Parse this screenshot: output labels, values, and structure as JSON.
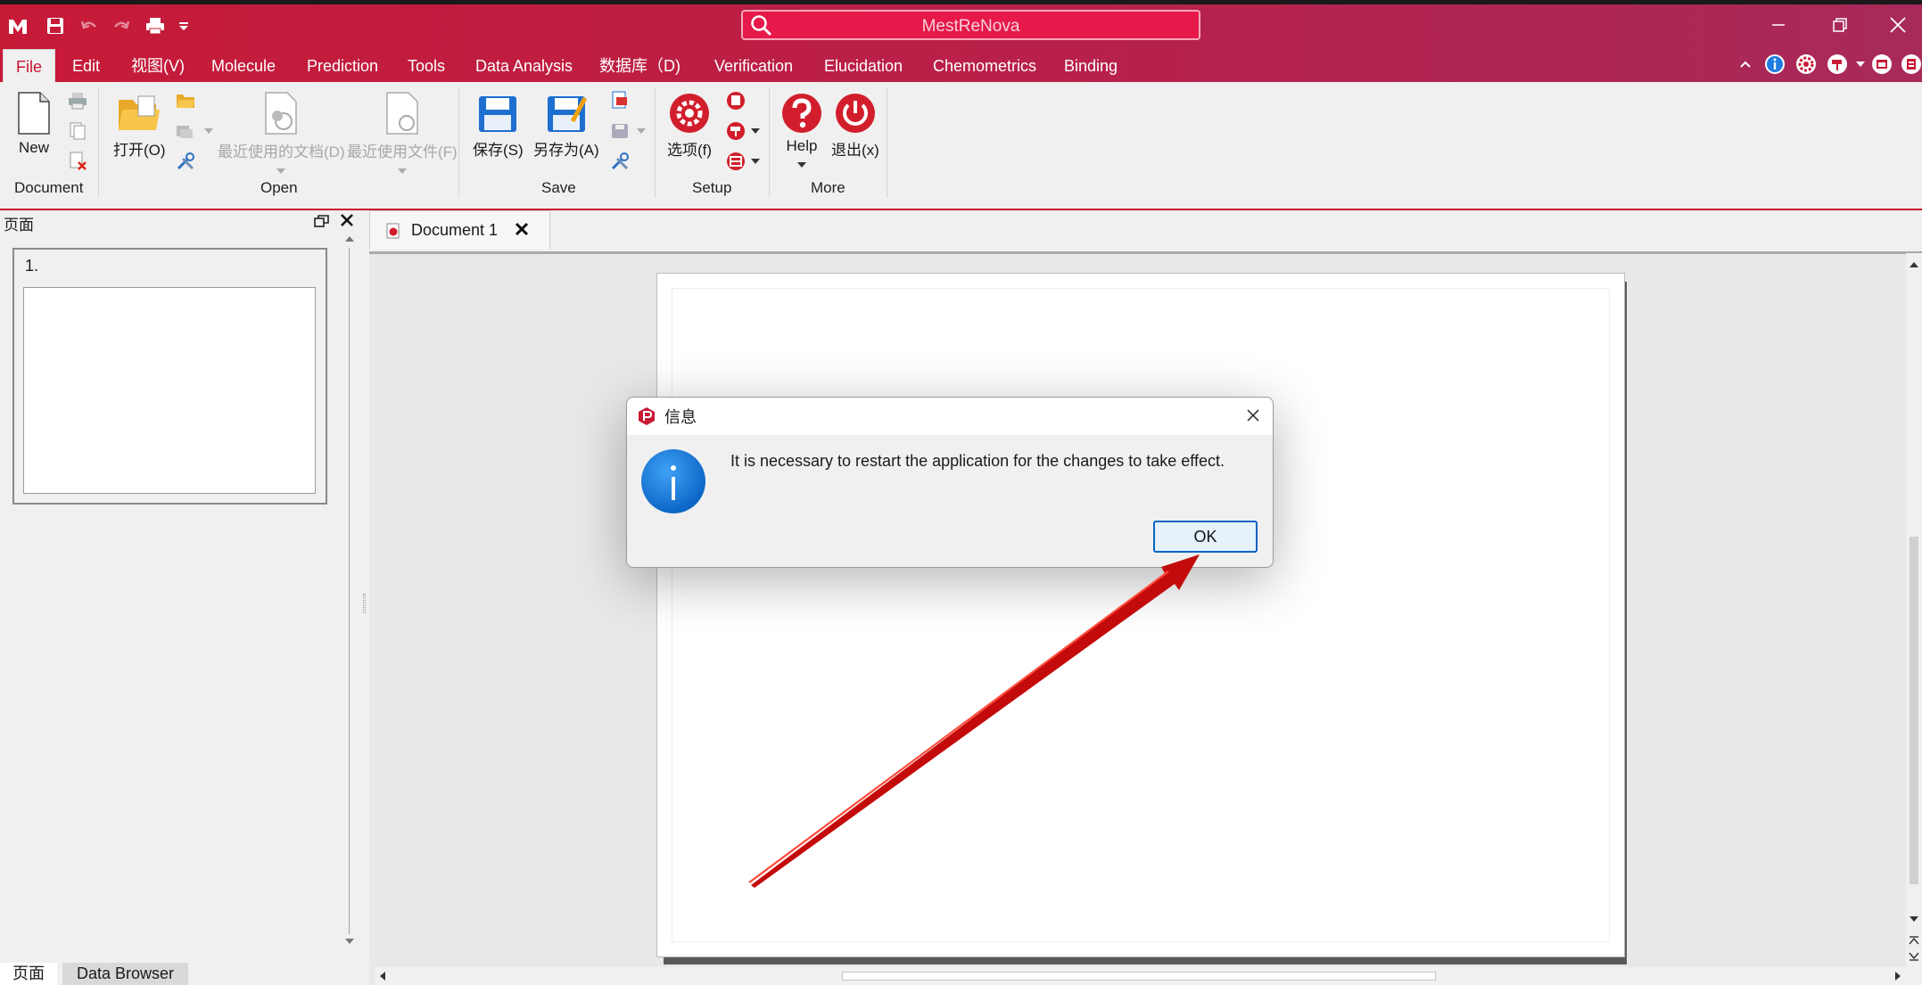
{
  "app": {
    "search_placeholder": "MestReNova"
  },
  "menu": {
    "items": [
      "File",
      "Edit",
      "视图(V)",
      "Molecule",
      "Prediction",
      "Tools",
      "Data Analysis",
      "数据库（D)",
      "Verification",
      "Elucidation",
      "Chemometrics",
      "Binding"
    ],
    "active": "File"
  },
  "ribbon": {
    "new_label": "New",
    "open_label": "打开(O)",
    "recent_docs_label": "最近使用的文档(D)",
    "recent_files_label": "最近使用文件(F)",
    "save_label": "保存(S)",
    "save_as_label": "另存为(A)",
    "options_label": "选项(f)",
    "help_label": "Help",
    "exit_label": "退出(x)",
    "groups": {
      "document": "Document",
      "open": "Open",
      "save": "Save",
      "setup": "Setup",
      "more": "More"
    }
  },
  "left_panel": {
    "title": "页面",
    "page_number": "1.",
    "bottom_tabs": [
      "页面",
      "Data Browser"
    ]
  },
  "document_tab": {
    "label": "Document 1"
  },
  "dialog": {
    "title": "信息",
    "message": "It is necessary to restart the application for the changes to take effect.",
    "ok_label": "OK"
  },
  "colors": {
    "brand": "#c71a37",
    "dialog_button_border": "#0b63c4",
    "info_icon": "#0a7ad8",
    "annotation_arrow": "#e01010"
  },
  "icons": [
    "app-logo-icon",
    "save-icon",
    "undo-icon",
    "redo-icon",
    "print-icon",
    "customize-icon",
    "search-icon",
    "minimize-icon",
    "restore-icon",
    "close-icon",
    "info-icon",
    "settings-icon",
    "paint-icon",
    "calendar-icon",
    "new-document-icon",
    "open-folder-icon",
    "gear-icon",
    "help-icon",
    "power-icon"
  ]
}
